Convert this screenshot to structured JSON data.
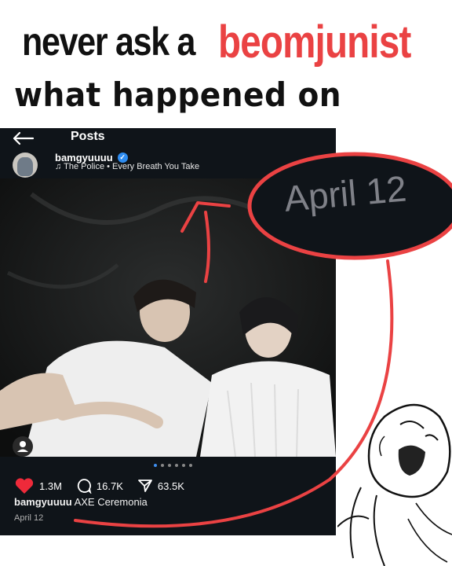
{
  "meme": {
    "line1_part1": "never ask a",
    "line1_part2": "beomjunist",
    "line2": "what happened on",
    "zoom_text": "April 12"
  },
  "post_screen": {
    "header_title": "Posts",
    "username": "bamgyuuuu",
    "music": "The Police • Every Breath You Take",
    "likes": "1.3M",
    "comments": "16.7K",
    "shares": "63.5K",
    "caption_user": "bamgyuuuu",
    "caption_text": "AXE Ceremonia",
    "date": "April 12"
  },
  "colors": {
    "accent_red": "#ea4243",
    "ig_bg": "#0f1419",
    "verified_blue": "#2e8cf0"
  }
}
